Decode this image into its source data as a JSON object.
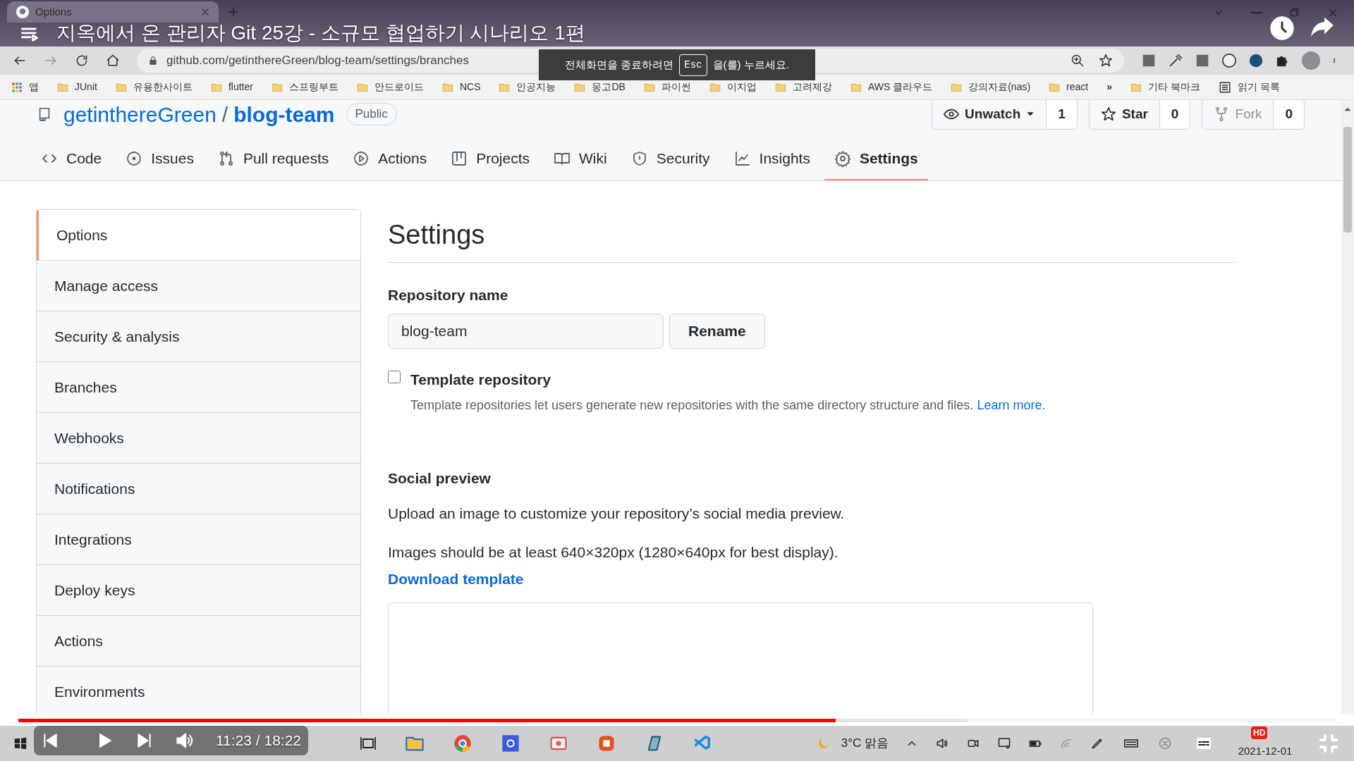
{
  "video": {
    "title": "지옥에서 온 관리자 Git 25강 - 소규모 협업하기 시나리오 1편",
    "time": "11:23 / 18:22",
    "progress": {
      "level": 0.62
    }
  },
  "browser": {
    "tab_title": "Options",
    "url": "github.com/getinthereGreen/blog-team/settings/branches",
    "fullscreen_notice": {
      "before": "전체화면을 종료하려면",
      "key": "Esc",
      "after": "을(를) 누르세요."
    },
    "bookmarks": [
      {
        "kind": "apps",
        "label": "앱"
      },
      {
        "kind": "folder",
        "label": "JUnit"
      },
      {
        "kind": "folder",
        "label": "유용한사이트"
      },
      {
        "kind": "folder",
        "label": "flutter"
      },
      {
        "kind": "folder",
        "label": "스프링부트"
      },
      {
        "kind": "folder",
        "label": "안드로이드"
      },
      {
        "kind": "folder",
        "label": "NCS"
      },
      {
        "kind": "folder",
        "label": "인공지능"
      },
      {
        "kind": "folder",
        "label": "몽고DB"
      },
      {
        "kind": "folder",
        "label": "파이썬"
      },
      {
        "kind": "folder",
        "label": "이지업"
      },
      {
        "kind": "folder",
        "label": "고려제강"
      },
      {
        "kind": "folder",
        "label": "AWS 클라우드"
      },
      {
        "kind": "folder",
        "label": "강의자료(nas)"
      },
      {
        "kind": "folder",
        "label": "react"
      },
      {
        "kind": "more",
        "label": "»"
      },
      {
        "kind": "folder",
        "label": "기타 북마크"
      },
      {
        "kind": "reading",
        "label": "읽기 목록"
      }
    ]
  },
  "repo": {
    "owner": "getinthereGreen",
    "separator": "/",
    "name": "blog-team",
    "visibility": "Public",
    "actions": [
      {
        "kind": "watch",
        "label": "Unwatch",
        "count": "1",
        "disabled": false
      },
      {
        "kind": "star",
        "label": "Star",
        "count": "0",
        "disabled": false
      },
      {
        "kind": "fork",
        "label": "Fork",
        "count": "0",
        "disabled": true
      }
    ]
  },
  "tabs": [
    {
      "kind": "code",
      "label": "Code",
      "selected": false
    },
    {
      "kind": "issues",
      "label": "Issues",
      "selected": false
    },
    {
      "kind": "pulls",
      "label": "Pull requests",
      "selected": false
    },
    {
      "kind": "actions",
      "label": "Actions",
      "selected": false
    },
    {
      "kind": "projects",
      "label": "Projects",
      "selected": false
    },
    {
      "kind": "wiki",
      "label": "Wiki",
      "selected": false
    },
    {
      "kind": "security",
      "label": "Security",
      "selected": false
    },
    {
      "kind": "insights",
      "label": "Insights",
      "selected": false
    },
    {
      "kind": "settings",
      "label": "Settings",
      "selected": true
    }
  ],
  "sidebar": {
    "items": [
      {
        "label": "Options",
        "selected": true
      },
      {
        "label": "Manage access",
        "selected": false
      },
      {
        "label": "Security & analysis",
        "selected": false
      },
      {
        "label": "Branches",
        "selected": false
      },
      {
        "label": "Webhooks",
        "selected": false
      },
      {
        "label": "Notifications",
        "selected": false
      },
      {
        "label": "Integrations",
        "selected": false
      },
      {
        "label": "Deploy keys",
        "selected": false
      },
      {
        "label": "Actions",
        "selected": false
      },
      {
        "label": "Environments",
        "selected": false
      }
    ]
  },
  "settings": {
    "heading": "Settings",
    "name_label": "Repository name",
    "name_value": "blog-team",
    "rename": "Rename",
    "template": {
      "label": "Template repository",
      "checked": false,
      "description": "Template repositories let users generate new repositories with the same directory structure and files.",
      "link": "Learn more."
    },
    "social": {
      "heading": "Social preview",
      "text": "Upload an image to customize your repository’s social media preview.",
      "size_text": "Images should be at least 640×320px (1280×640px for best display).",
      "link": "Download template"
    }
  },
  "taskbar": {
    "weather": "3°C 맑음",
    "date": "2021-12-01",
    "badge": "HD"
  }
}
